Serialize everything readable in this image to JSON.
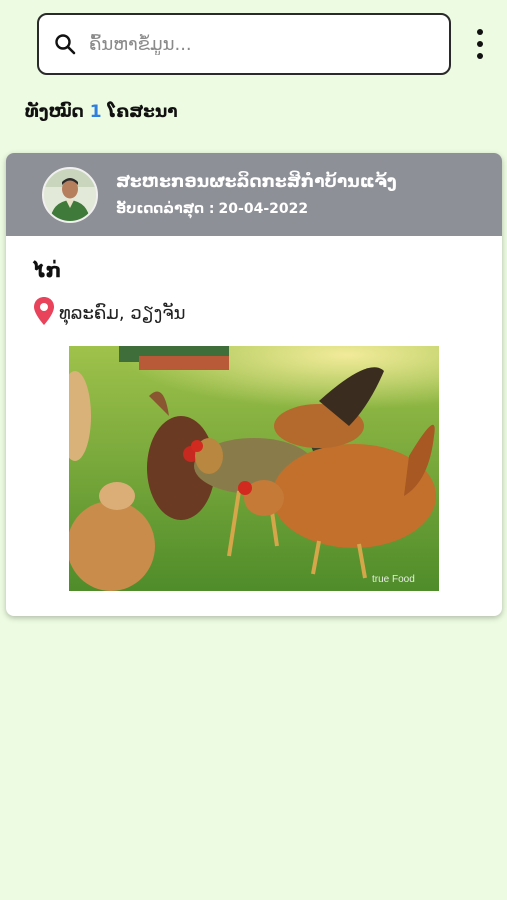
{
  "search": {
    "placeholder": "ຄົ້ນຫາຂໍ້ມູນ...",
    "icon": "search-icon"
  },
  "menu": {
    "icon": "more-vertical-icon"
  },
  "summary": {
    "prefix": "ທັງໝົດ",
    "count": "1",
    "suffix": "ໂຄສະນາ"
  },
  "listing": {
    "seller_name": "ສະຫະກອນຜະລິດກະສິກຳບ້ານແຈ້ງ",
    "updated_label": "ອັບເດດລ່າສຸດ :",
    "updated_date": "20-04-2022",
    "product": "ໄກ່",
    "location": "ທຸລະຄົມ, ວຽງຈັນ",
    "location_icon": "map-pin-icon",
    "photo_watermark": "true Food"
  },
  "colors": {
    "background": "#ecfbe1",
    "header": "#8e9097",
    "count_accent": "#2f7fe0",
    "pin": "#e8435a"
  }
}
